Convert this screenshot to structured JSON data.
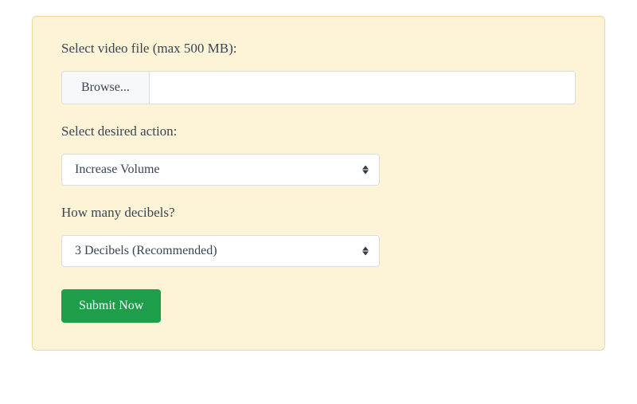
{
  "form": {
    "file": {
      "label": "Select video file (max 500 MB):",
      "browse_label": "Browse...",
      "selected_name": ""
    },
    "action": {
      "label": "Select desired action:",
      "selected": "Increase Volume"
    },
    "decibels": {
      "label": "How many decibels?",
      "selected": "3 Decibels (Recommended)"
    },
    "submit_label": "Submit Now"
  }
}
